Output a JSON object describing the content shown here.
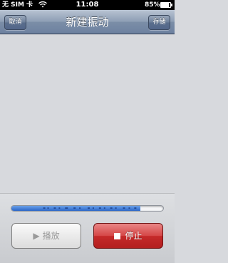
{
  "status_bar": {
    "carrier": "无 SIM 卡",
    "time": "11:08",
    "battery_percent": "85%",
    "battery_level": 0.85,
    "icons": [
      "wifi-icon",
      "battery-icon"
    ]
  },
  "nav": {
    "title": "新建振动",
    "cancel_label": "取消",
    "save_label": "存储"
  },
  "timeline": {
    "progress": 0.85,
    "fill_color": "#2b66c8"
  },
  "controls": {
    "play_label": "播放",
    "play_icon": "play-icon",
    "stop_label": "停止",
    "stop_icon": "stop-icon",
    "stop_color": "#c52a2a"
  }
}
